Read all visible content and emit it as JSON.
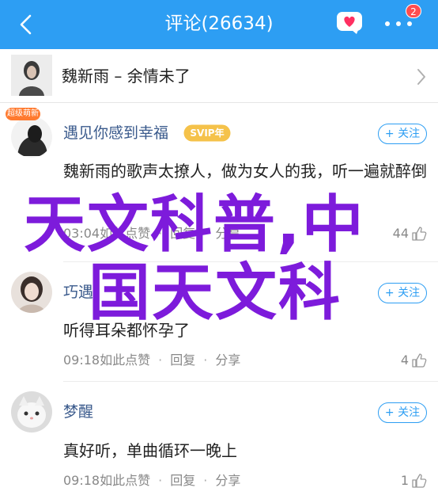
{
  "nav": {
    "title": "评论(26634)",
    "badge": "2",
    "bg_color": "#2d9ef3"
  },
  "song": {
    "text": "魏新雨 – 余情未了"
  },
  "follow_label": "+ 关注",
  "actions": {
    "reply": "回复",
    "share": "分享"
  },
  "comments": [
    {
      "user": "遇见你感到幸福",
      "vip": "SVIP年",
      "avatar_badge": "超级萌新",
      "text": "魏新雨的歌声太撩人，做为女人的我，听一遍就醉倒",
      "time": "03:04如此点赞",
      "likes": "44"
    },
    {
      "user": "巧遇",
      "text": "听得耳朵都怀孕了",
      "time": "09:18如此点赞",
      "likes": "4"
    },
    {
      "user": "梦醒",
      "text": "真好听，单曲循环一晚上",
      "time": "09:18如此点赞",
      "likes": "1"
    }
  ],
  "watermark": {
    "line1": "天文科普,中",
    "line2": "国天文科",
    "color": "#7d1bdb"
  }
}
